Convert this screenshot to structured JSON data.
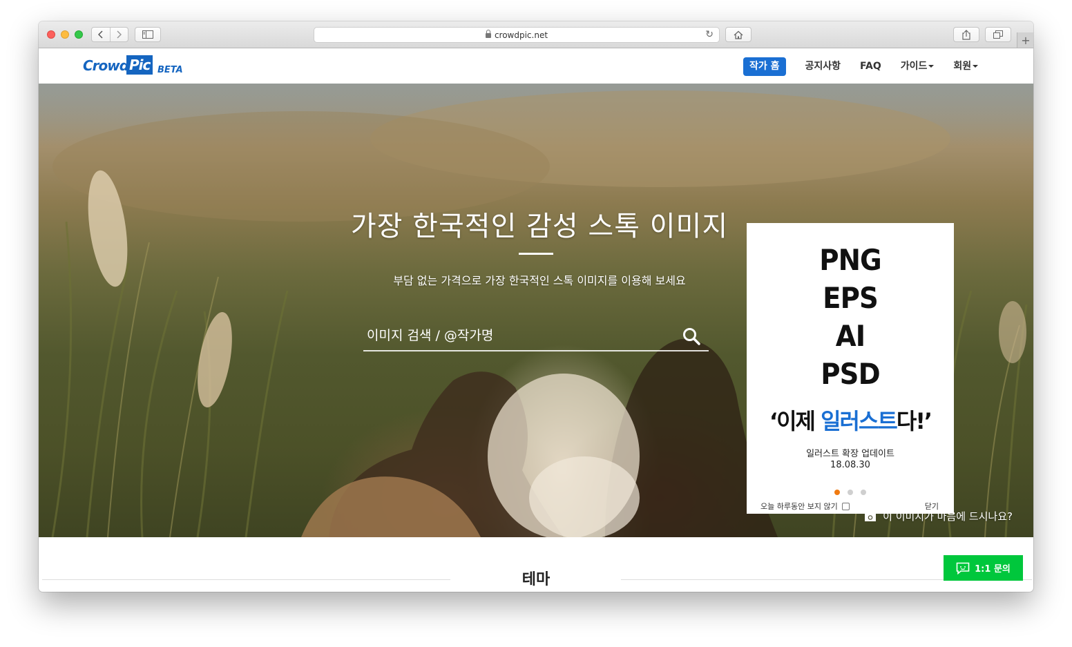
{
  "browser": {
    "url": "crowdpic.net"
  },
  "nav": {
    "logo_crowd": "Crowd",
    "logo_pic": "Pic",
    "logo_beta": "BETA",
    "menu": [
      {
        "label": "작가 홈"
      },
      {
        "label": "공지사항"
      },
      {
        "label": "FAQ"
      },
      {
        "label": "가이드"
      },
      {
        "label": "회원"
      }
    ]
  },
  "hero": {
    "title": "가장 한국적인 감성 스톡 이미지",
    "subtitle": "부담 없는 가격으로 가장 한국적인 스톡 이미지를 이용해 보세요",
    "search_placeholder": "이미지 검색 / @작가명",
    "camera_note": "이 이미지가 마음에 드시나요?"
  },
  "popup": {
    "formats": [
      "PNG",
      "EPS",
      "AI",
      "PSD"
    ],
    "slogan_prefix": "‘이제 ",
    "slogan_highlight": "일러스트",
    "slogan_suffix": "다!’",
    "update_text": "일러스트 확장 업데이트",
    "update_date": "18.08.30",
    "slide_count": 3,
    "active_slide": 1,
    "dont_show_label": "오늘 하루동안 보지 않기",
    "close_label": "닫기"
  },
  "section": {
    "title": "테마"
  },
  "chat_button": {
    "label": "1:1 문의"
  },
  "colors": {
    "brand_blue": "#1a6fd3",
    "chat_green": "#00c73c",
    "dot_active": "#f07a10"
  }
}
